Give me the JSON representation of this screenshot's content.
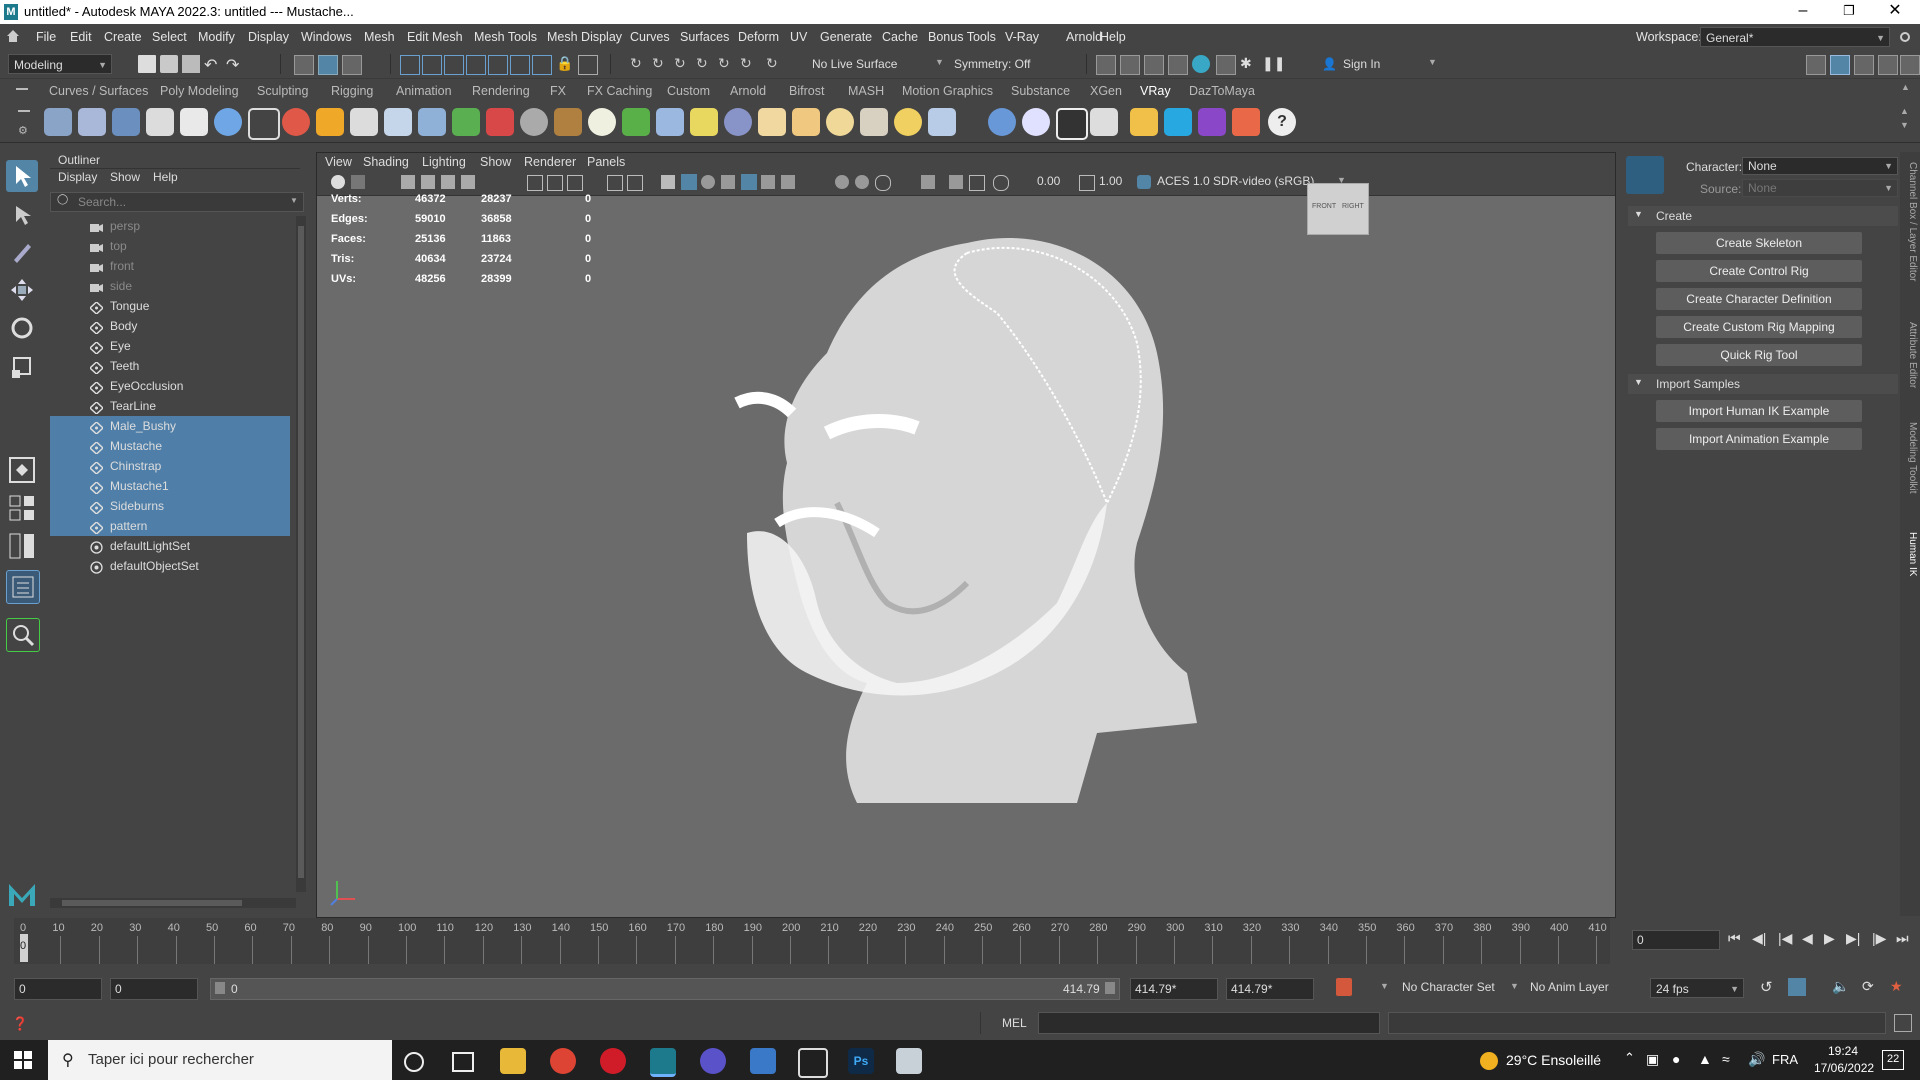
{
  "window": {
    "title": "untitled* - Autodesk MAYA 2022.3: untitled  ---  Mustache...",
    "icon": "maya-icon"
  },
  "menu": [
    "File",
    "Edit",
    "Create",
    "Select",
    "Modify",
    "Display",
    "Windows",
    "Mesh",
    "Edit Mesh",
    "Mesh Tools",
    "Mesh Display",
    "Curves",
    "Surfaces",
    "Deform",
    "UV",
    "Generate",
    "Cache",
    "Bonus Tools",
    "V-Ray",
    "Arnold",
    "Help"
  ],
  "workspace": {
    "label": "Workspace:",
    "value": "General*"
  },
  "toolbar": {
    "mode": "Modeling",
    "live_surface": "No Live Surface",
    "symmetry": "Symmetry: Off",
    "sign_in": "Sign In"
  },
  "shelf_tabs": [
    "Curves / Surfaces",
    "Poly Modeling",
    "Sculpting",
    "Rigging",
    "Animation",
    "Rendering",
    "FX",
    "FX Caching",
    "Custom",
    "Arnold",
    "Bifrost",
    "MASH",
    "Motion Graphics",
    "Substance",
    "XGen",
    "VRay",
    "DazToMaya"
  ],
  "active_shelf_tab": "VRay",
  "outliner": {
    "title": "Outliner",
    "menu": [
      "Display",
      "Show",
      "Help"
    ],
    "search_placeholder": "Search...",
    "items": [
      {
        "label": "persp",
        "kind": "camera",
        "dim": true,
        "selected": false
      },
      {
        "label": "top",
        "kind": "camera",
        "dim": true,
        "selected": false
      },
      {
        "label": "front",
        "kind": "camera",
        "dim": true,
        "selected": false
      },
      {
        "label": "side",
        "kind": "camera",
        "dim": true,
        "selected": false
      },
      {
        "label": "Tongue",
        "kind": "mesh",
        "dim": false,
        "selected": false
      },
      {
        "label": "Body",
        "kind": "mesh",
        "dim": false,
        "selected": false
      },
      {
        "label": "Eye",
        "kind": "mesh",
        "dim": false,
        "selected": false
      },
      {
        "label": "Teeth",
        "kind": "mesh",
        "dim": false,
        "selected": false
      },
      {
        "label": "EyeOcclusion",
        "kind": "mesh",
        "dim": false,
        "selected": false
      },
      {
        "label": "TearLine",
        "kind": "mesh",
        "dim": false,
        "selected": false
      },
      {
        "label": "Male_Bushy",
        "kind": "mesh",
        "dim": false,
        "selected": true
      },
      {
        "label": "Mustache",
        "kind": "mesh",
        "dim": false,
        "selected": true
      },
      {
        "label": "Chinstrap",
        "kind": "mesh",
        "dim": false,
        "selected": true
      },
      {
        "label": "Mustache1",
        "kind": "mesh",
        "dim": false,
        "selected": true
      },
      {
        "label": "Sideburns",
        "kind": "mesh",
        "dim": false,
        "selected": true
      },
      {
        "label": "pattern",
        "kind": "mesh",
        "dim": false,
        "selected": true
      },
      {
        "label": "defaultLightSet",
        "kind": "set",
        "dim": false,
        "selected": false
      },
      {
        "label": "defaultObjectSet",
        "kind": "set",
        "dim": false,
        "selected": false
      }
    ]
  },
  "viewport": {
    "menu": [
      "View",
      "Shading",
      "Lighting",
      "Show",
      "Renderer",
      "Panels"
    ],
    "exposure": "0.00",
    "gamma": "1.00",
    "color_space": "ACES 1.0 SDR-video (sRGB)",
    "hud": [
      {
        "label": "Verts:",
        "a": "46372",
        "b": "28237",
        "c": "0"
      },
      {
        "label": "Edges:",
        "a": "59010",
        "b": "36858",
        "c": "0"
      },
      {
        "label": "Faces:",
        "a": "25136",
        "b": "11863",
        "c": "0"
      },
      {
        "label": "Tris:",
        "a": "40634",
        "b": "23724",
        "c": "0"
      },
      {
        "label": "UVs:",
        "a": "48256",
        "b": "28399",
        "c": "0"
      }
    ],
    "viewcube": {
      "front": "FRONT",
      "right": "RIGHT"
    }
  },
  "hik": {
    "character_label": "Character:",
    "character_value": "None",
    "source_label": "Source:",
    "source_value": "None",
    "create_header": "Create",
    "create_buttons": [
      "Create Skeleton",
      "Create Control Rig",
      "Create Character Definition",
      "Create Custom Rig Mapping",
      "Quick Rig Tool"
    ],
    "import_header": "Import Samples",
    "import_buttons": [
      "Import Human IK Example",
      "Import Animation Example"
    ]
  },
  "side_tabs": [
    "Channel Box / Layer Editor",
    "Attribute Editor",
    "Modeling Toolkit",
    "Human IK"
  ],
  "timeline": {
    "ticks": [
      "10",
      "20",
      "30",
      "40",
      "50",
      "60",
      "70",
      "80",
      "90",
      "100",
      "110",
      "120",
      "130",
      "140",
      "150",
      "160",
      "170",
      "180",
      "190",
      "200",
      "210",
      "220",
      "230",
      "240",
      "250",
      "260",
      "270",
      "280",
      "290",
      "300",
      "310",
      "320",
      "330",
      "340",
      "350",
      "360",
      "370",
      "380",
      "390",
      "400",
      "410"
    ],
    "start_label": "0",
    "current_frame": "0",
    "current_marker": "0"
  },
  "range": {
    "start": "0",
    "anim_start": "0",
    "slider_start": "0",
    "slider_end": "414.79",
    "anim_end": "414.79*",
    "end": "414.79*",
    "character_set": "No Character Set",
    "anim_layer": "No Anim Layer",
    "fps": "24 fps"
  },
  "command_line": {
    "label": "MEL"
  },
  "taskbar": {
    "search_placeholder": "Taper ici pour rechercher",
    "weather": "29°C  Ensoleillé",
    "language": "FRA",
    "time": "19:24",
    "date": "17/06/2022",
    "notifications": "22"
  },
  "colors": {
    "selection": "#4f7fa8",
    "panel": "#444444",
    "viewport": "#6b6b6b",
    "accent": "#5285a6"
  }
}
